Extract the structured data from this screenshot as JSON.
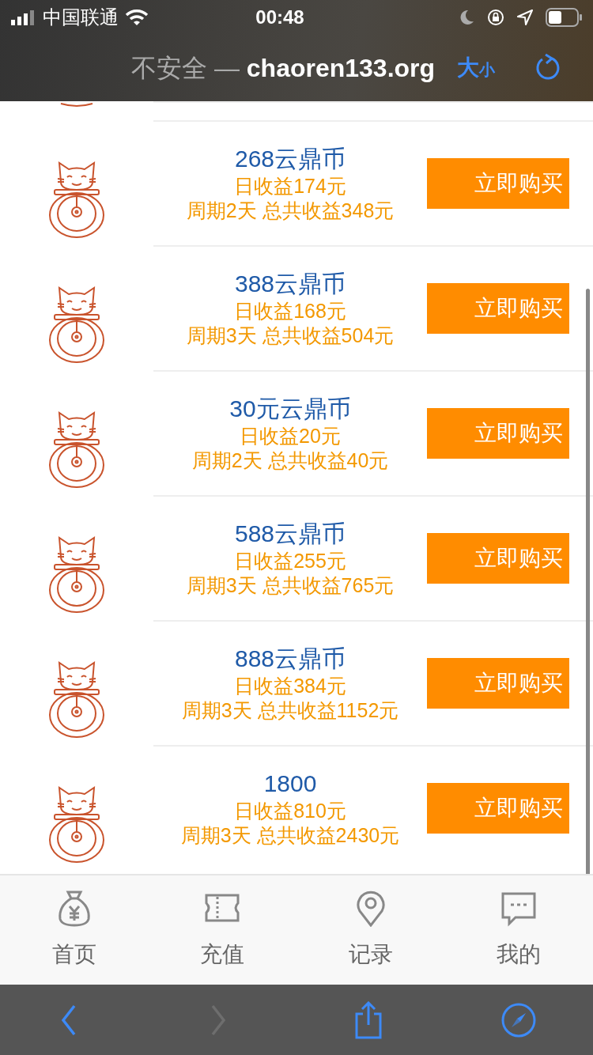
{
  "status_bar": {
    "carrier": "中国联通",
    "time": "00:48"
  },
  "address_bar": {
    "security": "不安全 — ",
    "domain": "chaoren133.org",
    "text_size": {
      "big": "大",
      "small": "小"
    }
  },
  "products": [
    {
      "name": "268云鼎币",
      "daily": "日收益174元",
      "period": "周期2天 总共收益348元",
      "button": "立即购买"
    },
    {
      "name": "388云鼎币",
      "daily": "日收益168元",
      "period": "周期3天 总共收益504元",
      "button": "立即购买"
    },
    {
      "name": "30元云鼎币",
      "daily": "日收益20元",
      "period": "周期2天 总共收益40元",
      "button": "立即购买"
    },
    {
      "name": "588云鼎币",
      "daily": "日收益255元",
      "period": "周期3天 总共收益765元",
      "button": "立即购买"
    },
    {
      "name": "888云鼎币",
      "daily": "日收益384元",
      "period": "周期3天 总共收益1152元",
      "button": "立即购买"
    },
    {
      "name": "1800",
      "daily": "日收益810元",
      "period": "周期3天 总共收益2430元",
      "button": "立即购买"
    }
  ],
  "tab_bar": [
    {
      "kind": "money",
      "label": "首页"
    },
    {
      "kind": "ticket",
      "label": "充值"
    },
    {
      "kind": "pin",
      "label": "记录"
    },
    {
      "kind": "chat",
      "label": "我的"
    }
  ],
  "toolbar": [
    {
      "kind": "back",
      "disabled": false
    },
    {
      "kind": "forward",
      "disabled": true
    },
    {
      "kind": "share",
      "disabled": false
    },
    {
      "kind": "compass",
      "disabled": false
    }
  ]
}
